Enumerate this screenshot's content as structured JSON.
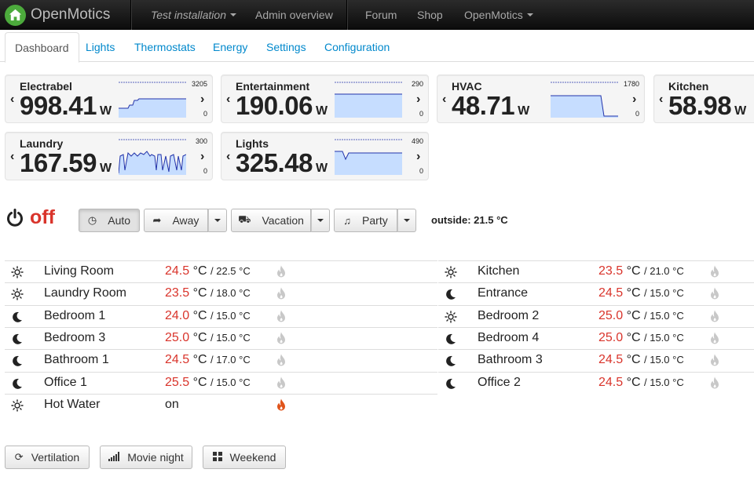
{
  "brand": {
    "name": "OpenMotics",
    "logo_icon": "house-logo-icon"
  },
  "nav": {
    "installation": "Test installation",
    "admin": "Admin overview",
    "forum": "Forum",
    "shop": "Shop",
    "openmotics": "OpenMotics"
  },
  "tabs": [
    "Dashboard",
    "Lights",
    "Thermostats",
    "Energy",
    "Settings",
    "Configuration"
  ],
  "energy": [
    {
      "name": "Electrabel",
      "value": "998.41",
      "unit": "W",
      "max": "3205",
      "min": "0"
    },
    {
      "name": "Entertainment",
      "value": "190.06",
      "unit": "W",
      "max": "290",
      "min": "0"
    },
    {
      "name": "HVAC",
      "value": "48.71",
      "unit": "W",
      "max": "1780",
      "min": "0"
    },
    {
      "name": "Kitchen",
      "value": "58.98",
      "unit": "W",
      "max": "",
      "min": ""
    },
    {
      "name": "Laundry",
      "value": "167.59",
      "unit": "W",
      "max": "300",
      "min": "0"
    },
    {
      "name": "Lights",
      "value": "325.48",
      "unit": "W",
      "max": "490",
      "min": "0"
    }
  ],
  "thermostat_mode": {
    "state": "off",
    "modes": [
      {
        "label": "Auto",
        "icon": "clock-icon",
        "active": true
      },
      {
        "label": "Away",
        "icon": "share-arrow-icon",
        "active": false
      },
      {
        "label": "Vacation",
        "icon": "car-icon",
        "active": false
      },
      {
        "label": "Party",
        "icon": "music-note-icon",
        "active": false
      }
    ],
    "outside": "outside: 21.5 °C"
  },
  "thermostats_left": [
    {
      "icon": "sun-icon",
      "name": "Living Room",
      "current": "24.5",
      "unit": "°C",
      "setpoint": "/ 22.5 °C",
      "flame": "inactive"
    },
    {
      "icon": "sun-icon",
      "name": "Laundry Room",
      "current": "23.5",
      "unit": "°C",
      "setpoint": "/ 18.0 °C",
      "flame": "inactive"
    },
    {
      "icon": "moon-icon",
      "name": "Bedroom 1",
      "current": "24.0",
      "unit": "°C",
      "setpoint": "/ 15.0 °C",
      "flame": "inactive"
    },
    {
      "icon": "moon-icon",
      "name": "Bedroom 3",
      "current": "25.0",
      "unit": "°C",
      "setpoint": "/ 15.0 °C",
      "flame": "inactive"
    },
    {
      "icon": "moon-icon",
      "name": "Bathroom 1",
      "current": "24.5",
      "unit": "°C",
      "setpoint": "/ 17.0 °C",
      "flame": "inactive"
    },
    {
      "icon": "moon-icon",
      "name": "Office 1",
      "current": "25.5",
      "unit": "°C",
      "setpoint": "/ 15.0 °C",
      "flame": "inactive"
    },
    {
      "icon": "sun-icon",
      "name": "Hot Water",
      "current": "",
      "unit": "on",
      "setpoint": "",
      "flame": "active"
    }
  ],
  "thermostats_right": [
    {
      "icon": "sun-icon",
      "name": "Kitchen",
      "current": "23.5",
      "unit": "°C",
      "setpoint": "/ 21.0 °C",
      "flame": "inactive"
    },
    {
      "icon": "moon-icon",
      "name": "Entrance",
      "current": "24.5",
      "unit": "°C",
      "setpoint": "/ 15.0 °C",
      "flame": "inactive"
    },
    {
      "icon": "sun-icon",
      "name": "Bedroom 2",
      "current": "25.0",
      "unit": "°C",
      "setpoint": "/ 15.0 °C",
      "flame": "inactive"
    },
    {
      "icon": "moon-icon",
      "name": "Bedroom 4",
      "current": "25.0",
      "unit": "°C",
      "setpoint": "/ 15.0 °C",
      "flame": "inactive"
    },
    {
      "icon": "moon-icon",
      "name": "Bathroom 3",
      "current": "24.5",
      "unit": "°C",
      "setpoint": "/ 15.0 °C",
      "flame": "inactive"
    },
    {
      "icon": "moon-icon",
      "name": "Office 2",
      "current": "24.5",
      "unit": "°C",
      "setpoint": "/ 15.0 °C",
      "flame": "inactive"
    }
  ],
  "scenes": [
    {
      "label": "Vertilation",
      "icon": "refresh-icon"
    },
    {
      "label": "Movie night",
      "icon": "signal-bars-icon"
    },
    {
      "label": "Weekend",
      "icon": "grid-icon"
    }
  ],
  "colors": {
    "navbar": "#111111",
    "link": "#0088cc",
    "temperature": "#d9342b",
    "flame_active": "#e0541b",
    "flame_inactive": "#c8c8c8",
    "sparkline_fill": "#c6ddff",
    "sparkline_line": "#2233aa"
  }
}
